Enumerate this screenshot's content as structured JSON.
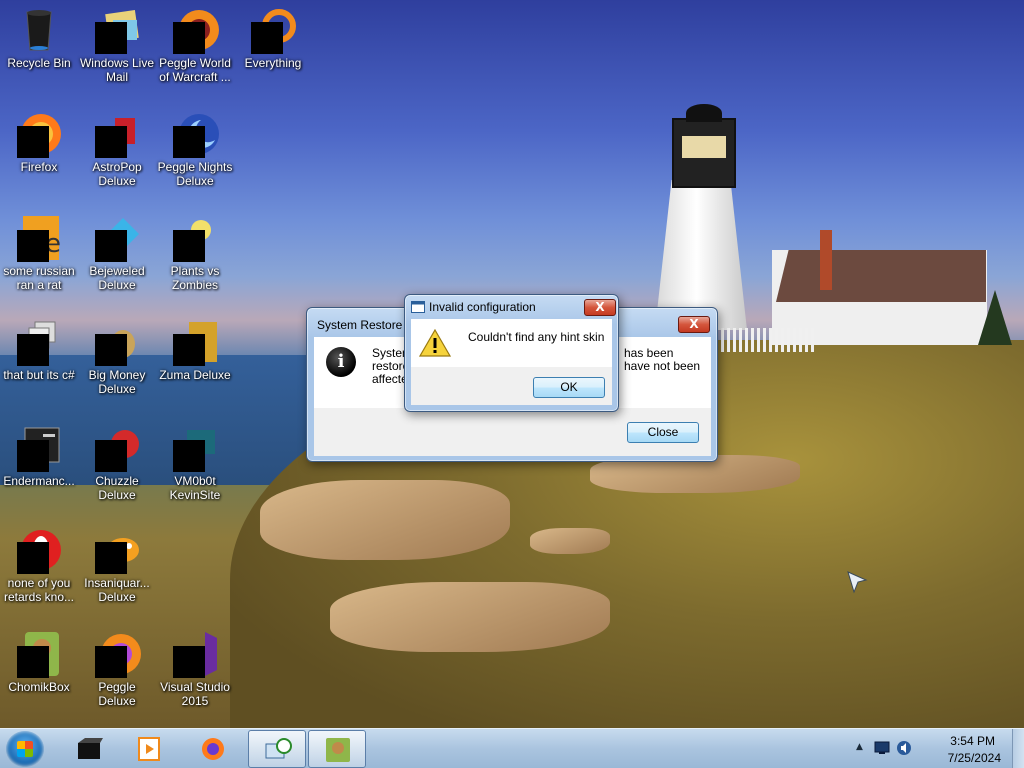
{
  "desktop": {
    "icons": [
      {
        "label": "Recycle Bin"
      },
      {
        "label": "Windows Live\nMail"
      },
      {
        "label": "Peggle World\nof Warcraft ..."
      },
      {
        "label": "Everything"
      },
      {
        "label": "Firefox"
      },
      {
        "label": "AstroPop\nDeluxe"
      },
      {
        "label": "Peggle Nights\nDeluxe"
      },
      {
        "label": "some russian\nran a rat"
      },
      {
        "label": "Bejeweled\nDeluxe"
      },
      {
        "label": "Plants vs\nZombies"
      },
      {
        "label": "that but its c#"
      },
      {
        "label": "Big Money\nDeluxe"
      },
      {
        "label": "Zuma Deluxe"
      },
      {
        "label": "Endermanc..."
      },
      {
        "label": "Chuzzle\nDeluxe"
      },
      {
        "label": "VM0b0t\nKevinSite"
      },
      {
        "label": "none of you\nretards kno..."
      },
      {
        "label": "Insaniquar...\nDeluxe"
      },
      {
        "label": "ChomikBox"
      },
      {
        "label": "Peggle Deluxe"
      },
      {
        "label": "Visual Studio\n2015"
      }
    ]
  },
  "system_restore": {
    "title": "System Restore",
    "text_left_1": "System",
    "text_left_2": "restore",
    "text_left_3": "affecte",
    "text_right_1": "has been",
    "text_right_2": "have not been",
    "close_button": "Close",
    "close_x": "X"
  },
  "invalid_config": {
    "title": "Invalid configuration",
    "message": "Couldn't find any hint skin",
    "ok_button": "OK",
    "close_x": "X"
  },
  "taskbar": {
    "clock_time": "3:54 PM",
    "clock_date": "7/25/2024",
    "tray_arrow": "▲"
  }
}
